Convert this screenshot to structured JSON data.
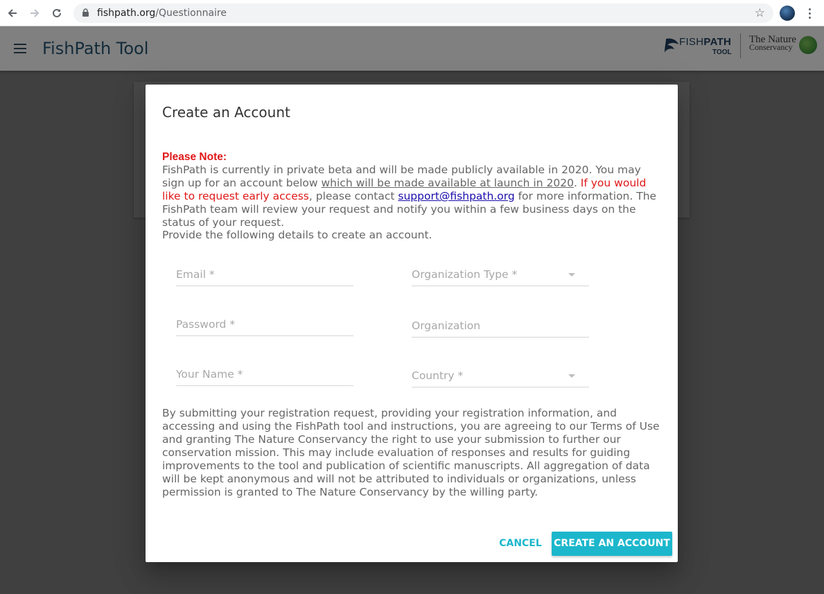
{
  "browser": {
    "url_host": "fishpath.org",
    "url_path": "/Questionnaire"
  },
  "app": {
    "title": "FishPath Tool",
    "logo_fish_bold": "FISH",
    "logo_path_bold": "PATH",
    "logo_tool": "TOOL",
    "logo_tnc_line1": "The Nature",
    "logo_tnc_line2": "Conservancy"
  },
  "modal": {
    "title": "Create an Account",
    "note_heading": "Please Note:",
    "note_part1": "FishPath is currently in private beta and will be made publicly available in 2020. You may sign up for an account below ",
    "note_underlined": "which will be made available at launch in 2020",
    "note_part2": ". ",
    "note_red": "If you would like to request early access",
    "note_part3": ", please contact ",
    "note_email": "support@fishpath.org",
    "note_part4": " for more information. The FishPath team will review your request and notify you within a few business days on the status of your request.",
    "provide_text": "Provide the following details to create an account.",
    "fields": {
      "email": "Email *",
      "password": "Password *",
      "your_name": "Your Name *",
      "organization_type": "Organization Type *",
      "organization": "Organization",
      "country": "Country *"
    },
    "terms_text": "By submitting your registration request, providing your registration information, and accessing and using the FishPath tool and instructions, you are agreeing to our Terms of Use and granting The Nature Conservancy the right to use your submission to further our conservation mission. This may include evaluation of responses and results for guiding improvements to the tool and publication of scientific manuscripts. All aggregation of data will be kept anonymous and will not be attributed to individuals or organizations, unless permission is granted to The Nature Conservancy by the willing party.",
    "cancel_label": "CANCEL",
    "create_label": "CREATE AN ACCOUNT"
  },
  "colors": {
    "accent": "#1cb7cc",
    "warning_red": "#e01818",
    "link_blue": "#1a0dab",
    "header_title": "#26536f"
  }
}
